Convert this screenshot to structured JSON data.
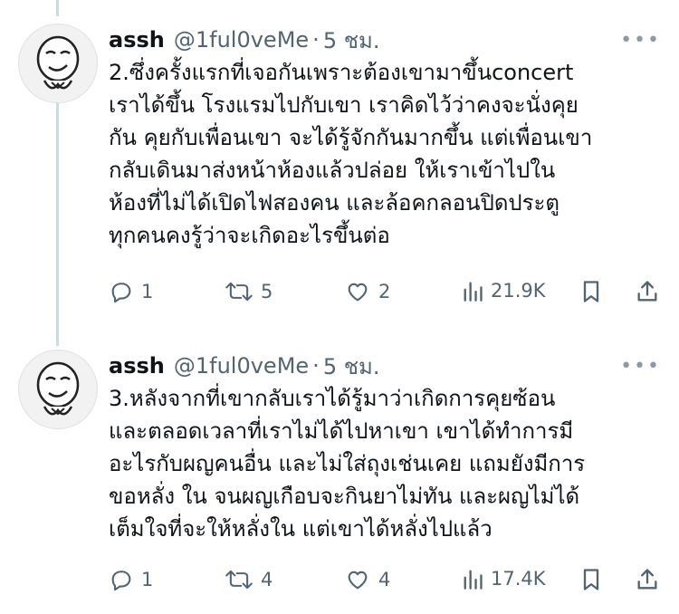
{
  "tweets": [
    {
      "name": "assh",
      "handle": "@1ful0veMe",
      "dot": "·",
      "time": "5 ชม.",
      "lines": [
        "2.ซึ่งครั้งแรกที่เจอกันเพราะต้องเขามาขึ้นconcert",
        "เราได้ขึ้น โรงแรมไปกับเขา เราคิดไว้ว่าคงจะนั่งคุย",
        "กัน คุยกับเพื่อนเขา จะได้รู้จักกันมากขึ้น แต่เพื่อนเขา",
        "กลับเดินมาส่งหน้าห้องแล้วปล่อย ให้เราเข้าไปใน",
        "ห้องที่ไม่ได้เปิดไฟสองคน และล้อคกลอนปิดประตู",
        "ทุกคนคงรู้ว่าจะเกิดอะไรขึ้นต่อ"
      ],
      "replies": "1",
      "retweets": "5",
      "likes": "2",
      "views": "21.9K"
    },
    {
      "name": "assh",
      "handle": "@1ful0veMe",
      "dot": "·",
      "time": "5 ชม.",
      "lines": [
        "3.หลังจากที่เขากลับเราได้รู้มาว่าเกิดการคุยซ้อน",
        "และตลอดเวลาที่เราไม่ได้ไปหาเขา เขาได้ทำการมี",
        "อะไรกับผญคนอื่น และไม่ใส่ถุงเช่นเคย แถมยังมีการ",
        "ขอหลั่ง ใน จนผญเกือบจะกินยาไม่ทัน และผญไม่ได้",
        "เต็มใจที่จะให้หลั่งใน แต่เขาได้หลั่งไปแล้ว"
      ],
      "replies": "1",
      "retweets": "4",
      "likes": "4",
      "views": "17.4K"
    }
  ],
  "icons": {
    "more": "more-dots-icon",
    "reply": "reply-icon",
    "retweet": "retweet-icon",
    "like": "heart-icon",
    "views": "views-icon",
    "bookmark": "bookmark-icon",
    "share": "share-icon"
  },
  "colors": {
    "text": "#0f1419",
    "muted": "#536471",
    "thread_line": "#cfd9de"
  }
}
